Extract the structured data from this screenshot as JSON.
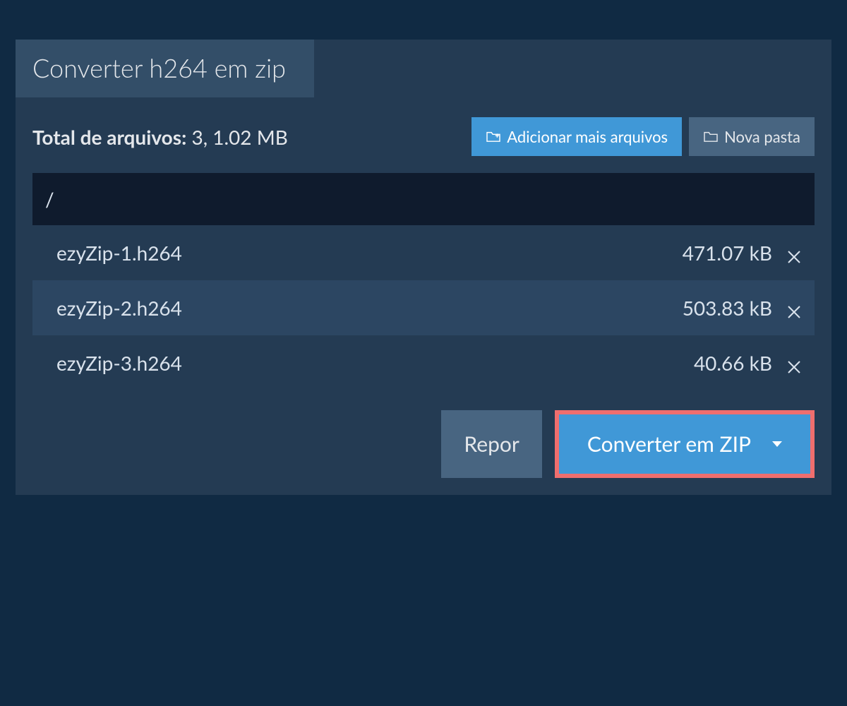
{
  "tab": {
    "title": "Converter h264 em zip"
  },
  "totals": {
    "label": "Total de arquivos:",
    "value": " 3, 1.02 MB"
  },
  "buttons": {
    "add_more": "Adicionar mais arquivos",
    "new_folder": "Nova pasta",
    "reset": "Repor",
    "convert": "Converter em ZIP"
  },
  "path": "/",
  "files": [
    {
      "name": "ezyZip-1.h264",
      "size": "471.07 kB"
    },
    {
      "name": "ezyZip-2.h264",
      "size": "503.83 kB"
    },
    {
      "name": "ezyZip-3.h264",
      "size": "40.66 kB"
    }
  ]
}
